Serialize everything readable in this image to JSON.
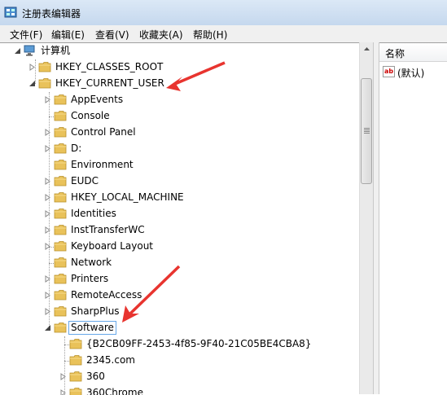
{
  "window": {
    "title": "注册表编辑器"
  },
  "menu": [
    "文件(F)",
    "编辑(E)",
    "查看(V)",
    "收藏夹(A)",
    "帮助(H)"
  ],
  "tree": {
    "root": "计算机",
    "hives": [
      {
        "label": "HKEY_CLASSES_ROOT",
        "state": "collapsed"
      },
      {
        "label": "HKEY_CURRENT_USER",
        "state": "expanded"
      }
    ],
    "hkcu_children": [
      {
        "label": "AppEvents",
        "state": "collapsed"
      },
      {
        "label": "Console",
        "state": "leaf"
      },
      {
        "label": "Control Panel",
        "state": "collapsed"
      },
      {
        "label": "D:",
        "state": "collapsed"
      },
      {
        "label": "Environment",
        "state": "leaf"
      },
      {
        "label": "EUDC",
        "state": "collapsed"
      },
      {
        "label": "HKEY_LOCAL_MACHINE",
        "state": "collapsed"
      },
      {
        "label": "Identities",
        "state": "collapsed"
      },
      {
        "label": "InstTransferWC",
        "state": "collapsed"
      },
      {
        "label": "Keyboard Layout",
        "state": "collapsed"
      },
      {
        "label": "Network",
        "state": "leaf"
      },
      {
        "label": "Printers",
        "state": "collapsed"
      },
      {
        "label": "RemoteAccess",
        "state": "collapsed"
      },
      {
        "label": "SharpPlus",
        "state": "collapsed"
      },
      {
        "label": "Software",
        "state": "expanded",
        "selected": true
      }
    ],
    "software_children": [
      {
        "label": "{B2CB09FF-2453-4f85-9F40-21C05BE4CBA8}",
        "state": "leaf"
      },
      {
        "label": "2345.com",
        "state": "leaf"
      },
      {
        "label": "360",
        "state": "collapsed"
      },
      {
        "label": "360Chrome",
        "state": "collapsed"
      }
    ]
  },
  "right_pane": {
    "column_header": "名称",
    "value_name": "(默认)"
  },
  "colors": {
    "accent": "#e8342f",
    "selection_border": "#66a7e8",
    "folder": "#e9c25a"
  }
}
